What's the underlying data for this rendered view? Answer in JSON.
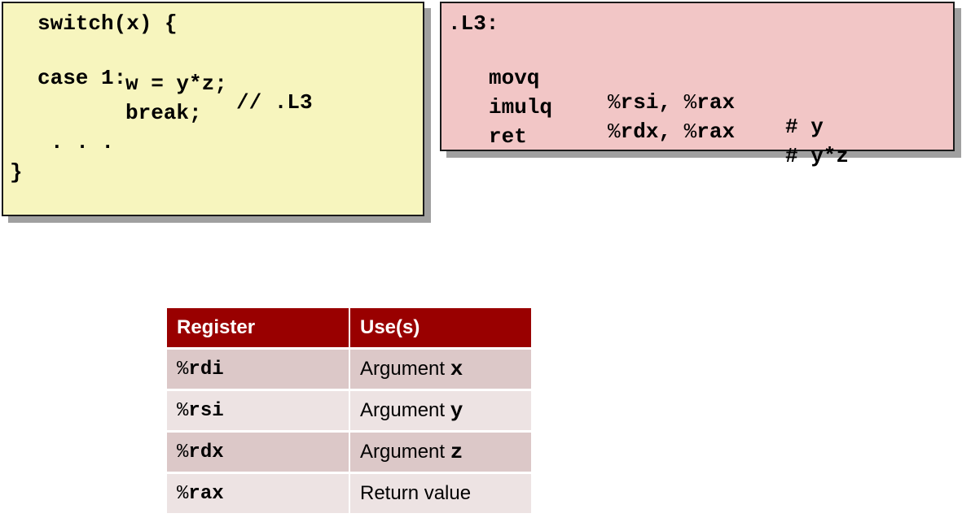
{
  "c_code": {
    "line1": "switch(x) {",
    "line2_case": "case 1:",
    "line2_comment": "// .L3",
    "line3": "w = y*z;",
    "line4": "break;",
    "line5": ". . .",
    "line6": "}"
  },
  "asm_code": {
    "label": ".L3:",
    "rows": [
      {
        "op": "movq",
        "args": "%rsi, %rax",
        "comment": "# y"
      },
      {
        "op": "imulq",
        "args": "%rdx, %rax",
        "comment": "# y*z"
      },
      {
        "op": "ret",
        "args": "",
        "comment": ""
      }
    ]
  },
  "register_table": {
    "headers": [
      "Register",
      "Use(s)"
    ],
    "rows": [
      {
        "register": "%rdi",
        "use_text": "Argument",
        "use_arg": "x"
      },
      {
        "register": "%rsi",
        "use_text": "Argument",
        "use_arg": "y"
      },
      {
        "register": "%rdx",
        "use_text": "Argument",
        "use_arg": "z"
      },
      {
        "register": "%rax",
        "use_text": "Return value",
        "use_arg": ""
      }
    ]
  },
  "colors": {
    "c_box_bg": "#f7f5be",
    "asm_box_bg": "#f2c6c6",
    "table_header_bg": "#990000",
    "table_row_odd": "#dcc8c8",
    "table_row_even": "#ede3e3"
  }
}
